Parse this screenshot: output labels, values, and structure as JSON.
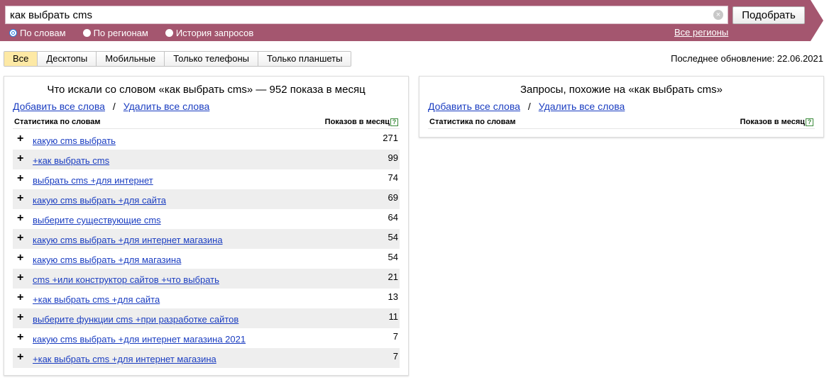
{
  "search": {
    "query": "как выбрать cms",
    "clear_glyph": "×",
    "submit_label": "Подобрать",
    "modes": [
      {
        "label": "По словам",
        "checked": true
      },
      {
        "label": "По регионам",
        "checked": false
      },
      {
        "label": "История запросов",
        "checked": false
      }
    ],
    "regions_link": "Все регионы",
    "band_color": "#a4566f"
  },
  "device_tabs": [
    {
      "label": "Все",
      "active": true
    },
    {
      "label": "Десктопы",
      "active": false
    },
    {
      "label": "Мобильные",
      "active": false
    },
    {
      "label": "Только телефоны",
      "active": false
    },
    {
      "label": "Только планшеты",
      "active": false
    }
  ],
  "last_update": "Последнее обновление: 22.06.2021",
  "left_panel": {
    "title": "Что искали со словом «как выбрать cms» — 952 показа в месяц",
    "add_all": "Добавить все слова",
    "separator": "/",
    "remove_all": "Удалить все слова",
    "col_stats": "Статистика по словам",
    "col_shows": "Показов в месяц",
    "help_glyph": "?",
    "plus_glyph": "+",
    "rows": [
      {
        "phrase": "какую cms выбрать",
        "count": "271"
      },
      {
        "phrase": "+как выбрать cms",
        "count": "99"
      },
      {
        "phrase": "выбрать cms +для интернет",
        "count": "74"
      },
      {
        "phrase": "какую cms выбрать +для сайта",
        "count": "69"
      },
      {
        "phrase": "выберите существующие cms",
        "count": "64"
      },
      {
        "phrase": "какую cms выбрать +для интернет магазина",
        "count": "54"
      },
      {
        "phrase": "какую cms выбрать +для магазина",
        "count": "54"
      },
      {
        "phrase": "cms +или конструктор сайтов +что выбрать",
        "count": "21"
      },
      {
        "phrase": "+как выбрать cms +для сайта",
        "count": "13"
      },
      {
        "phrase": "выберите функции cms +при разработке сайтов",
        "count": "11"
      },
      {
        "phrase": "какую cms выбрать +для интернет магазина 2021",
        "count": "7"
      },
      {
        "phrase": "+как выбрать cms +для интернет магазина",
        "count": "7"
      }
    ]
  },
  "right_panel": {
    "title": "Запросы, похожие на «как выбрать cms»",
    "add_all": "Добавить все слова",
    "separator": "/",
    "remove_all": "Удалить все слова",
    "col_stats": "Статистика по словам",
    "col_shows": "Показов в месяц",
    "help_glyph": "?"
  }
}
